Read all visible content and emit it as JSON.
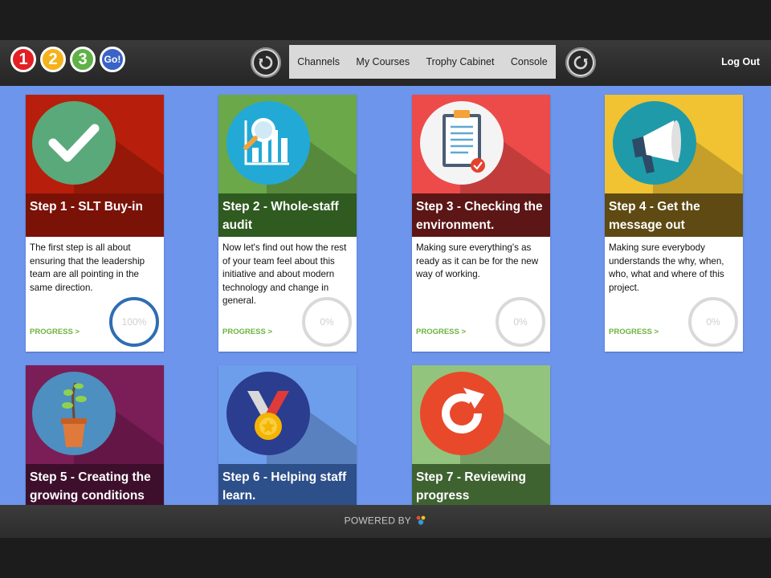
{
  "nav": {
    "logos": [
      "1",
      "2",
      "3",
      "Go!"
    ],
    "menu": [
      "Channels",
      "My Courses",
      "Trophy Cabinet",
      "Console"
    ],
    "logout": "Log Out"
  },
  "steps": [
    {
      "title": "Step 1 - SLT Buy-in",
      "desc": "The first step is all about ensuring that the leadership team are all pointing in the same direction.",
      "progress_label": "PROGRESS >",
      "percent": "100%",
      "progress_value": 1.0,
      "tile_color": "#b71e0c",
      "band_color": "#7a1208",
      "icon": "checkmark-icon"
    },
    {
      "title": "Step 2 - Whole-staff audit",
      "desc": "Now let's find out how the rest of your team feel about this initiative and about modern technology and change in general.",
      "progress_label": "PROGRESS >",
      "percent": "0%",
      "progress_value": 0.0,
      "tile_color": "#6aa84a",
      "band_color": "#2f5a20",
      "icon": "chart-magnifier-icon"
    },
    {
      "title": "Step 3 - Checking the environment.",
      "desc": "Making sure everything's as ready as it can be for the new way of working.",
      "progress_label": "PROGRESS >",
      "percent": "0%",
      "progress_value": 0.0,
      "tile_color": "#ed4a4a",
      "band_color": "#5c1616",
      "icon": "clipboard-icon"
    },
    {
      "title": "Step 4 - Get the message out",
      "desc": "Making sure everybody understands the why, when, who, what and where of this project.",
      "progress_label": "PROGRESS >",
      "percent": "0%",
      "progress_value": 0.0,
      "tile_color": "#f1c232",
      "band_color": "#5e4a12",
      "icon": "megaphone-icon"
    },
    {
      "title": "Step 5 - Creating the growing conditions",
      "tile_color": "#7b1d57",
      "band_color": "#3d0f2c",
      "icon": "plant-icon"
    },
    {
      "title": "Step 6 - Helping staff learn.",
      "tile_color": "#6d9eeb",
      "band_color": "#2d4f8a",
      "icon": "medal-icon"
    },
    {
      "title": "Step 7 - Reviewing progress",
      "tile_color": "#93c47d",
      "band_color": "#3f6231",
      "icon": "refresh-icon"
    }
  ],
  "footer": {
    "powered_by": "POWERED BY"
  }
}
